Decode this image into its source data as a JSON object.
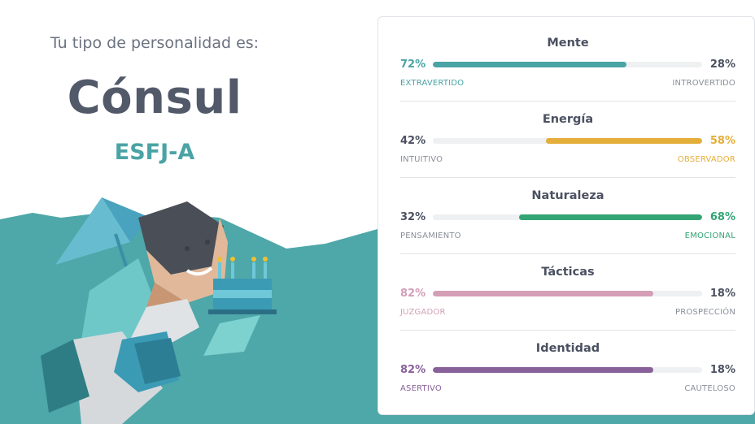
{
  "header": {
    "intro": "Tu tipo de personalidad es:",
    "type_name": "Cónsul",
    "type_code": "ESFJ-A"
  },
  "colors": {
    "teal": "#4aa3a5",
    "background_shape": "#4ea7a8",
    "text_gray": "#525a6a",
    "muted": "#6b7280"
  },
  "illustration": {
    "description_icon": "consul-character-with-umbrella-and-cake-icon"
  },
  "traits": [
    {
      "title": "Mente",
      "left_pct": "72%",
      "right_pct": "28%",
      "left_label": "EXTRAVERTIDO",
      "right_label": "INTROVERTIDO",
      "dominant": "left",
      "fill_fraction": 0.72,
      "color": "#4aa3a5"
    },
    {
      "title": "Energía",
      "left_pct": "42%",
      "right_pct": "58%",
      "left_label": "INTUITIVO",
      "right_label": "OBSERVADOR",
      "dominant": "right",
      "fill_fraction": 0.58,
      "color": "#e4ae3a"
    },
    {
      "title": "Naturaleza",
      "left_pct": "32%",
      "right_pct": "68%",
      "left_label": "PENSAMIENTO",
      "right_label": "EMOCIONAL",
      "dominant": "right",
      "fill_fraction": 0.68,
      "color": "#33a474"
    },
    {
      "title": "Tácticas",
      "left_pct": "82%",
      "right_pct": "18%",
      "left_label": "JUZGADOR",
      "right_label": "PROSPECCIÓN",
      "dominant": "left",
      "fill_fraction": 0.82,
      "color": "#d39eb6"
    },
    {
      "title": "Identidad",
      "left_pct": "82%",
      "right_pct": "18%",
      "left_label": "ASERTIVO",
      "right_label": "CAUTELOSO",
      "dominant": "left",
      "fill_fraction": 0.82,
      "color": "#88619a"
    }
  ]
}
